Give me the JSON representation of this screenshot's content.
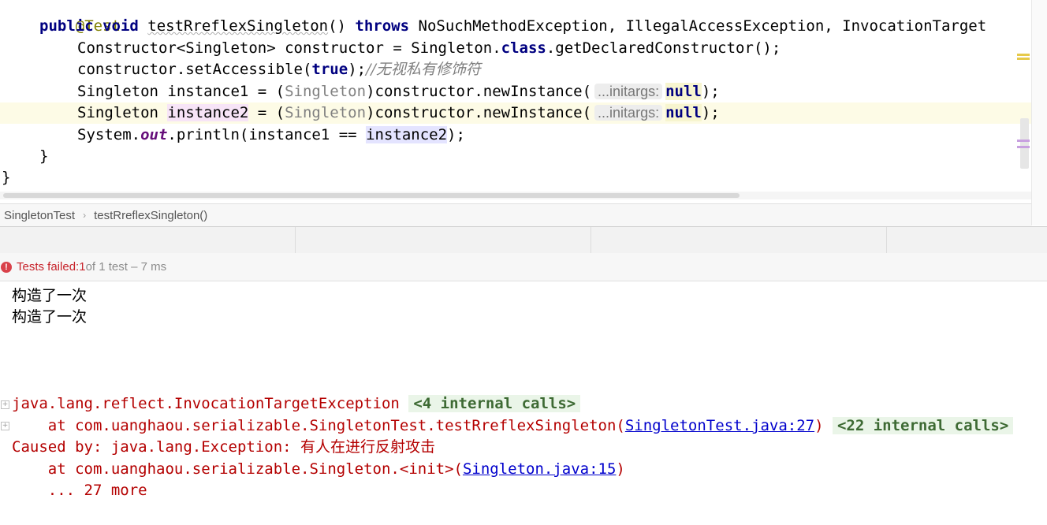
{
  "editor": {
    "annotation": "@Test",
    "method_modifiers": "public void",
    "method_name": "testRreflexSingleton",
    "method_params": "()",
    "throws_kw": "throws",
    "throws_list": "NoSuchMethodException, IllegalAccessException, InvocationTarget",
    "line3": {
      "p1": "Constructor<Singleton> constructor = Singleton.",
      "kw": "class",
      "p2": ".getDeclaredConstructor();"
    },
    "line4": {
      "p1": "constructor.setAccessible(",
      "kw": "true",
      "p2": ");",
      "comment": "//无视私有修饰符"
    },
    "line5": {
      "p1": "Singleton ",
      "var": "instance1",
      "p2": " = (",
      "cast": "Singleton",
      "p3": ")constructor.newInstance(",
      "hint": "...initargs:",
      "null": "null",
      "p4": ");"
    },
    "line6": {
      "p1": "Singleton ",
      "var": "instance2",
      "p2": " = (",
      "cast": "Singleton",
      "p3": ")constructor.newInstance(",
      "hint": "...initargs:",
      "null": "null",
      "p4": ");"
    },
    "line7": {
      "p1": "System.",
      "out": "out",
      "p2": ".println(instance1 == ",
      "var": "instance2",
      "p3": ");"
    },
    "close_method": "}",
    "close_class": "}"
  },
  "breadcrumb": {
    "class_name": "SingletonTest",
    "method_name": "testRreflexSingleton()"
  },
  "status": {
    "failed_label": "Tests failed: ",
    "failed_count": "1",
    "of_label": " of 1 test – 7 ms"
  },
  "console": {
    "output_lines": [
      "构造了一次",
      "构造了一次"
    ],
    "exception": "java.lang.reflect.InvocationTargetException",
    "internal1": "<4 internal calls>",
    "at1_prefix": "    at com.uanghaou.serializable.SingletonTest.testRreflexSingleton(",
    "at1_link": "SingletonTest.java:27",
    "at1_suffix": ") ",
    "internal2": "<22 internal calls>",
    "caused_prefix": "Caused by: java.lang.Exception: ",
    "caused_msg": "有人在进行反射攻击",
    "at2_prefix": "    at com.uanghaou.serializable.Singleton.<init>(",
    "at2_link": "Singleton.java:15",
    "at2_suffix": ")",
    "more": "    ... 27 more"
  },
  "colors": {
    "keyword": "#000080",
    "annotation": "#808000",
    "error": "#c7222a",
    "link": "#0000cc"
  }
}
